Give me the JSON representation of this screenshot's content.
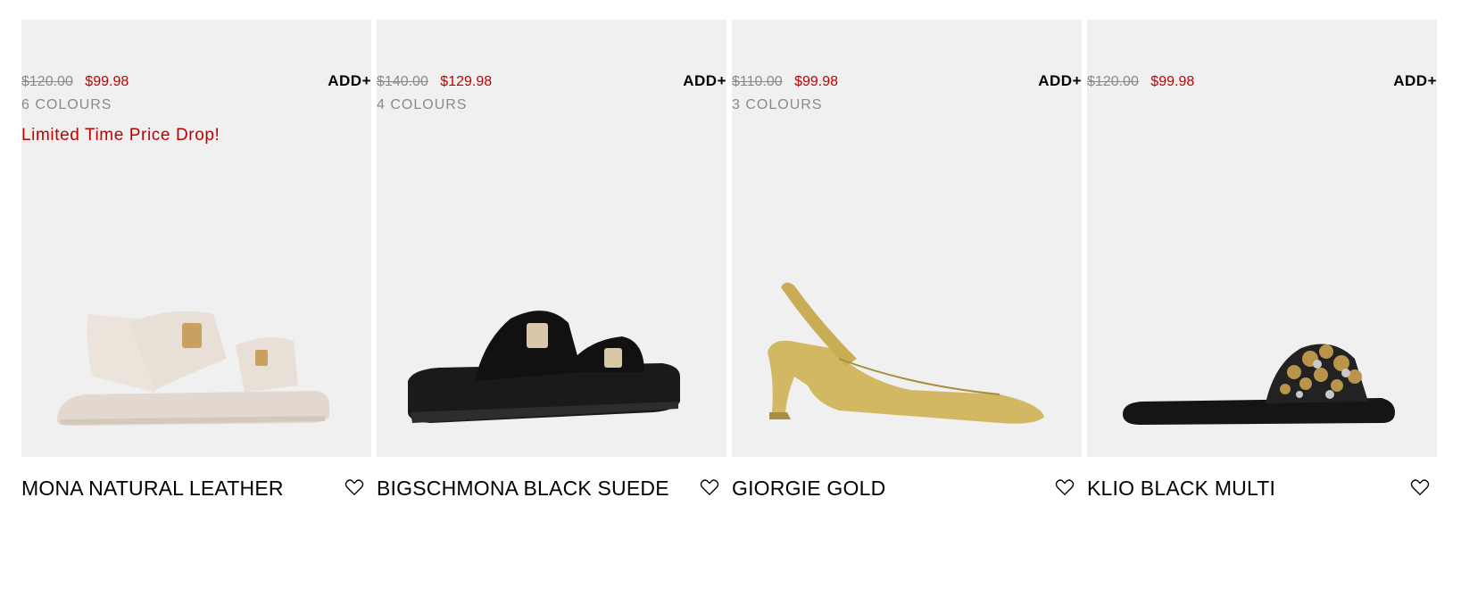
{
  "colors": {
    "sale_price": "#c00000",
    "muted": "#8a8a8a",
    "image_bg": "#f0f0f0"
  },
  "products": [
    {
      "title": "MONA NATURAL LEATHER",
      "old_price": "$120.00",
      "new_price": "$99.98",
      "colours": "6 COLOURS",
      "add_label": "ADD+",
      "promo": "Limited Time Price Drop!",
      "wishlist_icon": "heart-icon"
    },
    {
      "title": "BIGSCHMONA BLACK SUEDE",
      "old_price": "$140.00",
      "new_price": "$129.98",
      "colours": "4 COLOURS",
      "add_label": "ADD+",
      "wishlist_icon": "heart-icon"
    },
    {
      "title": "GIORGIE GOLD",
      "old_price": "$110.00",
      "new_price": "$99.98",
      "colours": "3 COLOURS",
      "add_label": "ADD+",
      "wishlist_icon": "heart-icon"
    },
    {
      "title": "KLIO BLACK MULTI",
      "old_price": "$120.00",
      "new_price": "$99.98",
      "add_label": "ADD+",
      "wishlist_icon": "heart-icon"
    }
  ]
}
